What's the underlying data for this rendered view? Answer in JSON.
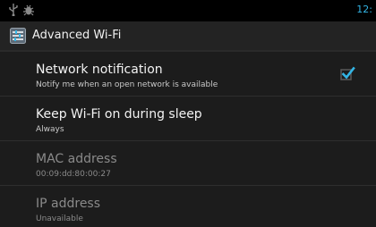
{
  "statusbar": {
    "time": "12:",
    "icons": [
      "usb-icon",
      "debug-icon"
    ]
  },
  "actionbar": {
    "title": "Advanced Wi-Fi",
    "icon": "settings-app-icon"
  },
  "settings": [
    {
      "title": "Network notification",
      "summary": "Notify me when an open network is available",
      "checked": true,
      "enabled": true
    },
    {
      "title": "Keep Wi-Fi on during sleep",
      "summary": "Always",
      "enabled": true
    },
    {
      "title": "MAC address",
      "summary": "00:09:dd:80:00:27",
      "enabled": false
    },
    {
      "title": "IP address",
      "summary": "Unavailable",
      "enabled": false
    }
  ],
  "colors": {
    "accent": "#33b5e5",
    "background": "#1c1c1c",
    "statusbar": "#000000"
  }
}
